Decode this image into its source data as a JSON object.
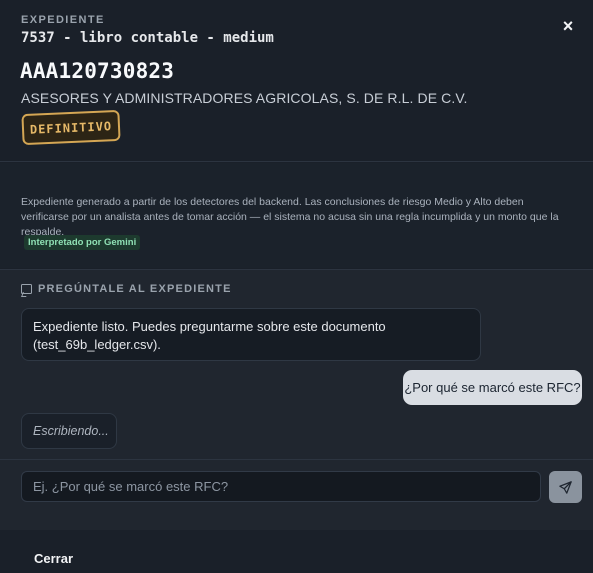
{
  "header": {
    "eyebrow": "EXPEDIENTE",
    "subtitle": "7537 - libro contable - medium",
    "rfc": "AAA120730823",
    "company": "ASESORES Y ADMINISTRADORES AGRICOLAS, S. DE R.L. DE C.V.",
    "status_badge": "DEFINITIVO",
    "close_icon": "×"
  },
  "notice": {
    "text": "Expediente generado a partir de los detectores del backend. Las conclusiones de riesgo Medio y Alto deben verificarse por un analista antes de tomar acción — el sistema no acusa sin una regla incumplida y un monto que la respalde.",
    "ai_tag": "Interpretado por Gemini"
  },
  "chat": {
    "title": "PREGÚNTALE AL EXPEDIENTE",
    "messages": [
      {
        "role": "assistant",
        "text": "Expediente listo. Puedes preguntarme sobre este documento (test_69b_ledger.csv)."
      },
      {
        "role": "user",
        "text": "¿Por qué se marcó este RFC?"
      }
    ],
    "typing": "Escribiendo..."
  },
  "composer": {
    "placeholder": "Ej. ¿Por qué se marcó este RFC?",
    "value": ""
  },
  "footer": {
    "close_label": "Cerrar"
  },
  "colors": {
    "background": "#1a2029",
    "badge": "#d4a654",
    "ai_tag": "#8fe0b4"
  },
  "icons": [
    "close-icon",
    "chat-bubble-icon",
    "send-icon"
  ]
}
